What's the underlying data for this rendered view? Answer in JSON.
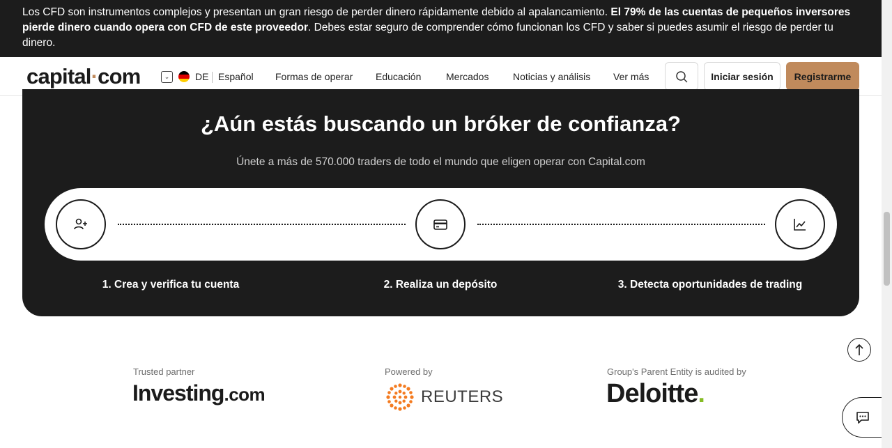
{
  "risk_banner": {
    "text_1": "Los CFD son instrumentos complejos y presentan un gran riesgo de perder dinero rápidamente debido al apalancamiento. ",
    "text_bold": "El 79% de las cuentas de pequeños inversores pierde dinero cuando opera con CFD de este proveedor",
    "text_2": ". Debes estar seguro de comprender cómo funcionan los CFD y saber si puedes asumir el riesgo de perder tu dinero."
  },
  "header": {
    "logo_part1": "capital",
    "logo_dot": "·",
    "logo_part2": "com",
    "lang_code": "DE",
    "lang_name": "Español",
    "nav": [
      "Formas de operar",
      "Educación",
      "Mercados",
      "Noticias y análisis",
      "Ver más"
    ],
    "login_label": "Iniciar sesión",
    "register_label": "Registrarme"
  },
  "promo": {
    "title": "¿Aún estás buscando un bróker de confianza?",
    "subtitle": "Únete a más de 570.000 traders de todo el mundo que eligen operar con Capital.com",
    "steps": [
      {
        "label": "1. Crea y verifica tu cuenta",
        "icon": "add-user-icon"
      },
      {
        "label": "2. Realiza un depósito",
        "icon": "credit-card-icon"
      },
      {
        "label": "3. Detecta oportunidades de trading",
        "icon": "chart-line-icon"
      }
    ]
  },
  "partners": {
    "trusted_caption": "Trusted partner",
    "investing_main": "Investing",
    "investing_suffix": ".com",
    "powered_caption": "Powered by",
    "reuters_name": "REUTERS",
    "audited_caption": "Group's Parent Entity is audited by",
    "deloitte_name": "Deloitte",
    "deloitte_dot": "."
  },
  "colors": {
    "accent": "#c08a5c",
    "dark": "#1c1c1c",
    "reuters_orange": "#f47b20",
    "deloitte_green": "#86bc25"
  }
}
